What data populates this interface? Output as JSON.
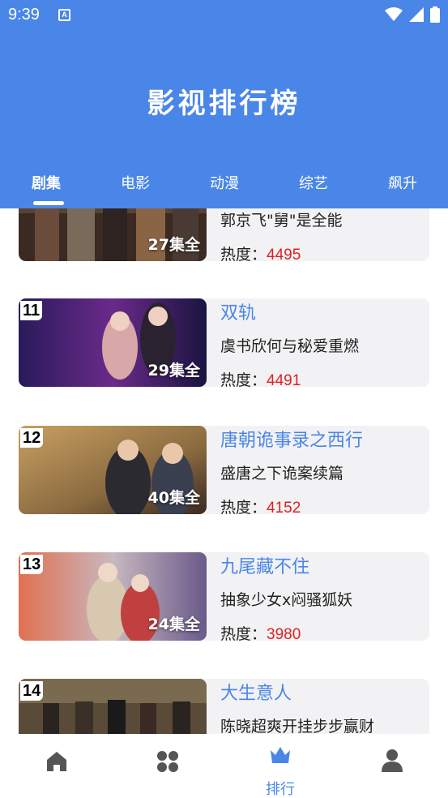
{
  "status_bar": {
    "time": "9:39",
    "notification": "A"
  },
  "header": {
    "title": "影视排行榜"
  },
  "tabs": [
    {
      "label": "剧集",
      "active": true
    },
    {
      "label": "电影",
      "active": false
    },
    {
      "label": "动漫",
      "active": false
    },
    {
      "label": "综艺",
      "active": false
    },
    {
      "label": "飙升",
      "active": false
    }
  ],
  "heat_prefix": "热度：",
  "items": [
    {
      "rank": "",
      "name": "",
      "episodes": "27集全",
      "desc": "郭京飞\"舅\"是全能",
      "heat": "4495"
    },
    {
      "rank": "11",
      "name": "双轨",
      "episodes": "29集全",
      "desc": "虞书欣何与秘爱重燃",
      "heat": "4491"
    },
    {
      "rank": "12",
      "name": "唐朝诡事录之西行",
      "episodes": "40集全",
      "desc": "盛唐之下诡案续篇",
      "heat": "4152"
    },
    {
      "rank": "13",
      "name": "九尾藏不住",
      "episodes": "24集全",
      "desc": "抽象少女x闷骚狐妖",
      "heat": "3980"
    },
    {
      "rank": "14",
      "name": "大生意人",
      "episodes": "",
      "desc": "陈晓超爽开挂步步赢财",
      "heat": ""
    }
  ],
  "bottom_nav": [
    {
      "icon": "home-icon",
      "label": ""
    },
    {
      "icon": "category-icon",
      "label": ""
    },
    {
      "icon": "crown-icon",
      "label": "排行",
      "active": true
    },
    {
      "icon": "user-icon",
      "label": ""
    }
  ],
  "colors": {
    "accent": "#4a86e8",
    "heat": "#e02020",
    "card_bg": "#f2f2f4"
  }
}
